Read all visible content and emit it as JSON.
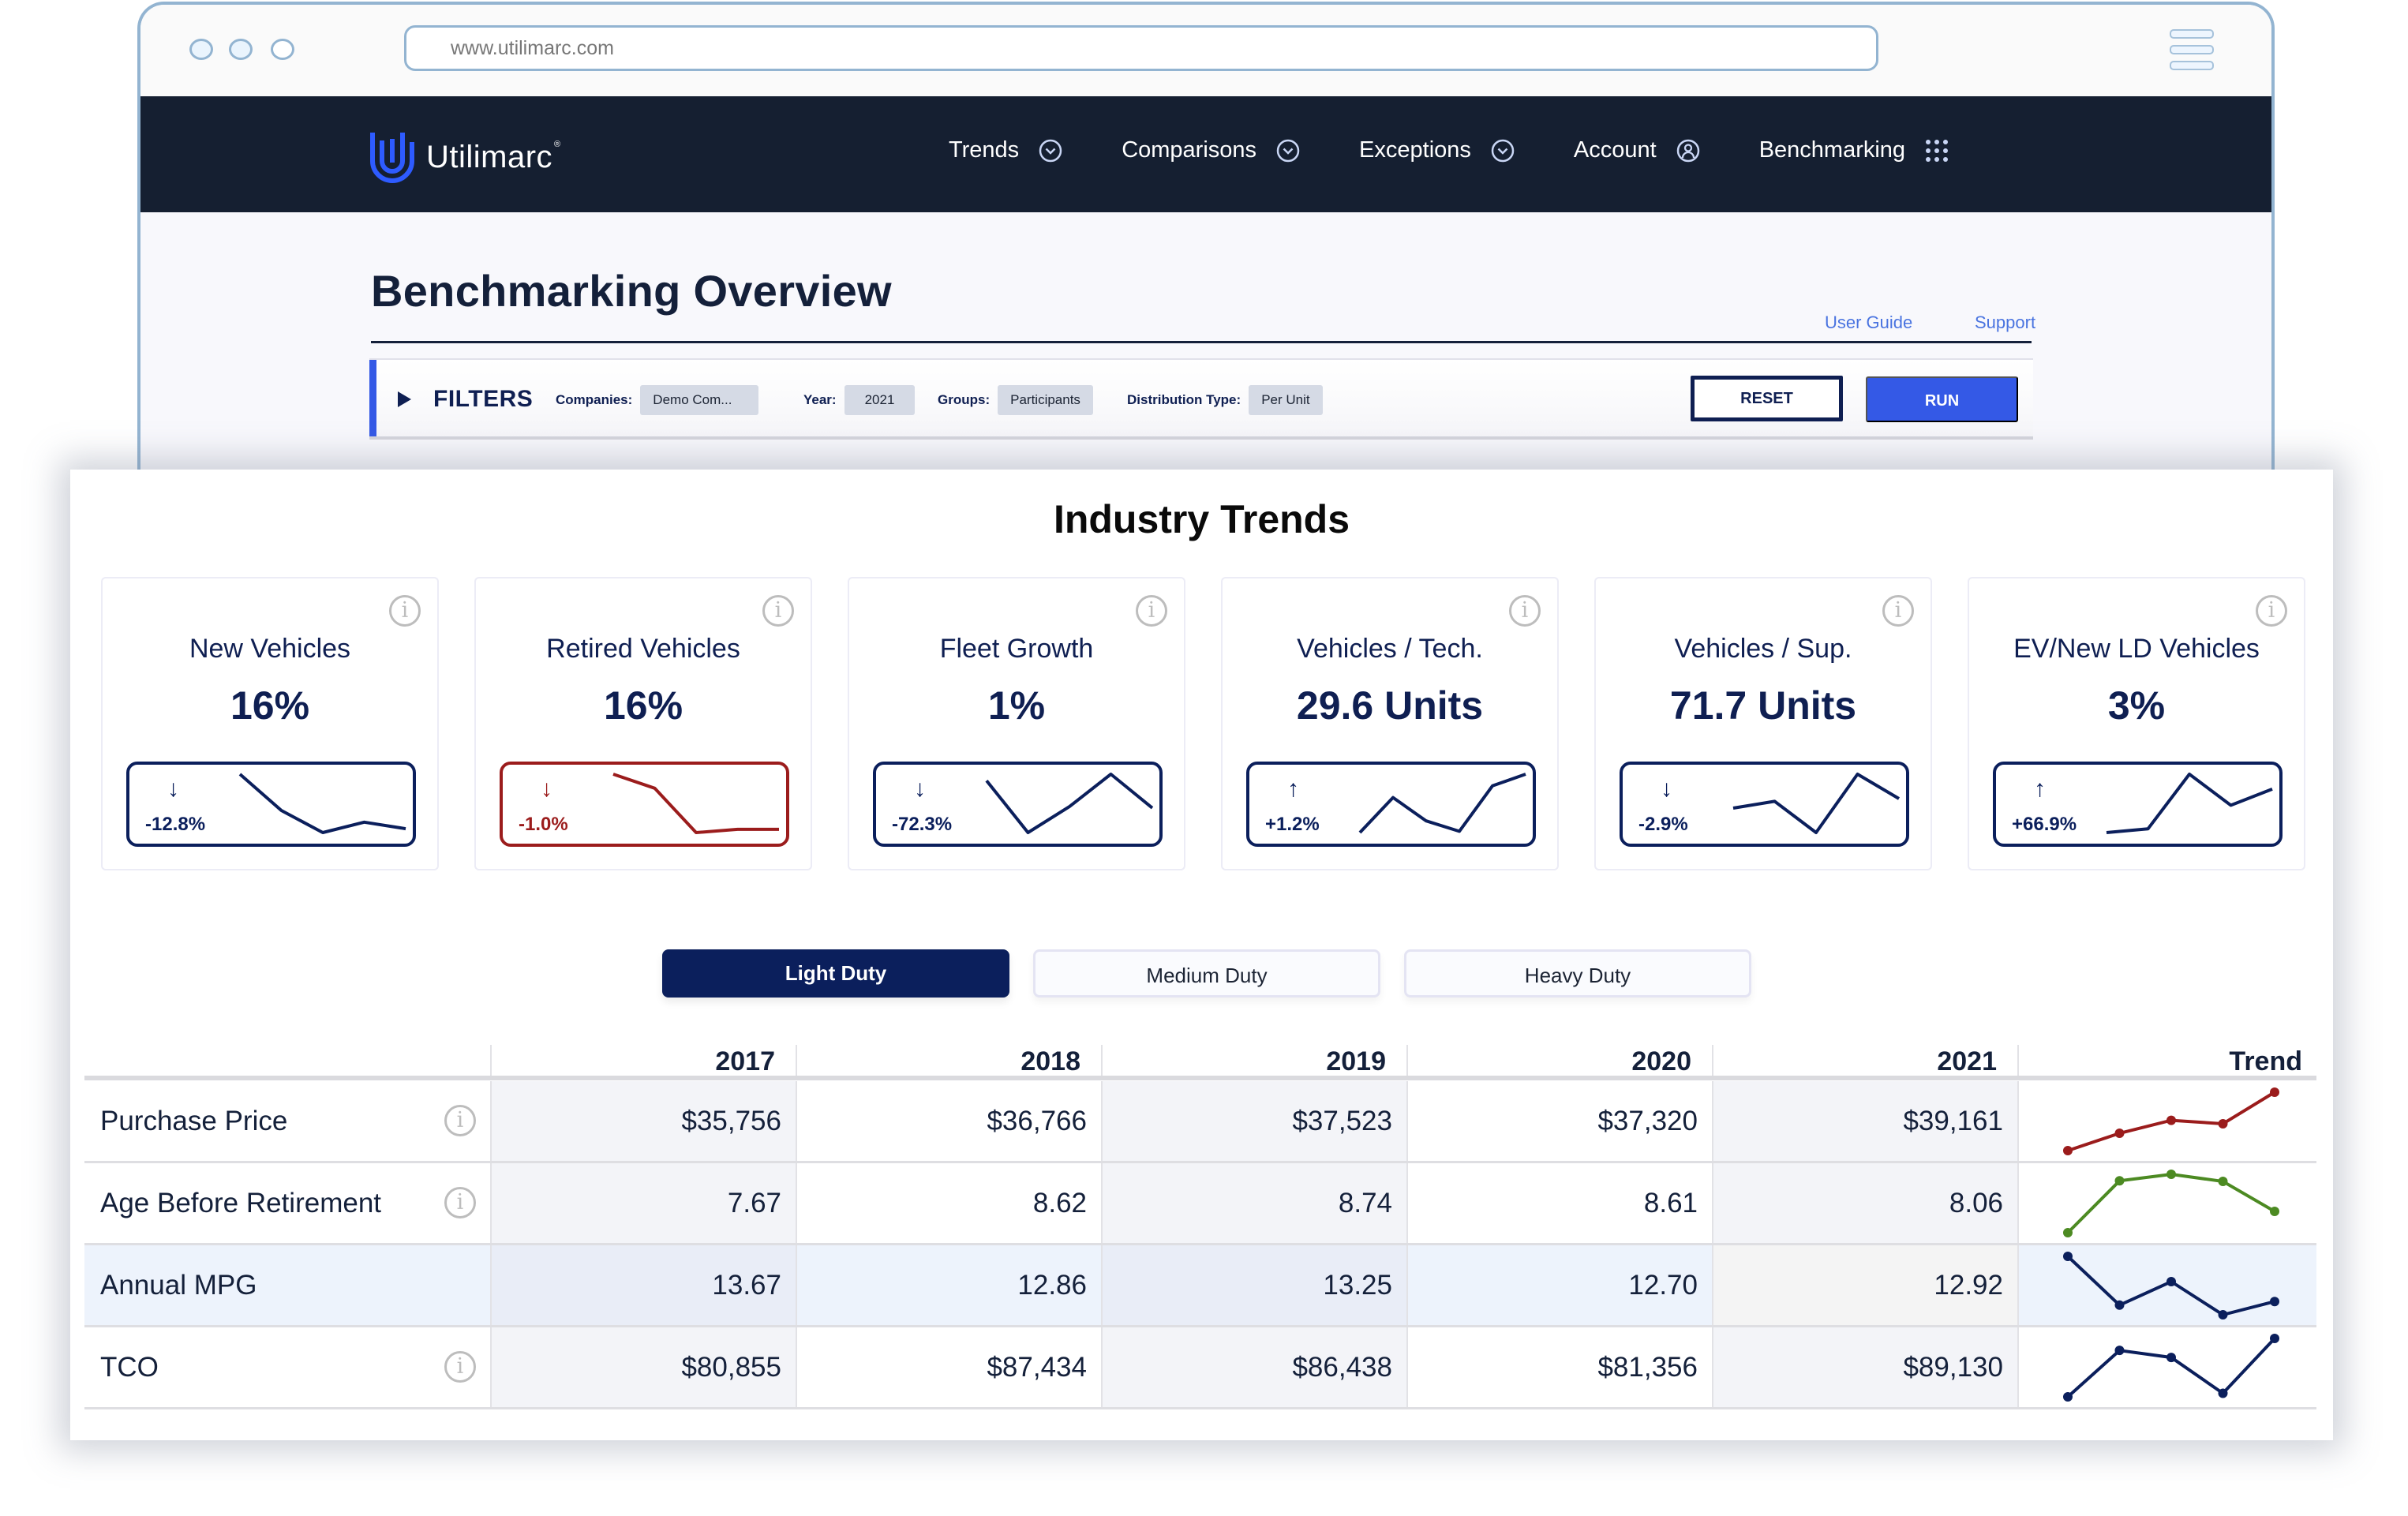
{
  "browser": {
    "url": "www.utilimarc.com"
  },
  "nav": {
    "brand": "Utilimarc",
    "brand_mark": "®",
    "items": [
      {
        "label": "Trends",
        "icon": "chevron-circle-down-icon"
      },
      {
        "label": "Comparisons",
        "icon": "chevron-circle-down-icon"
      },
      {
        "label": "Exceptions",
        "icon": "chevron-circle-down-icon"
      },
      {
        "label": "Account",
        "icon": "user-circle-icon"
      },
      {
        "label": "Benchmarking",
        "icon": "grid-dots-icon"
      }
    ]
  },
  "page": {
    "title": "Benchmarking Overview",
    "links": {
      "user_guide": "User Guide",
      "support": "Support"
    }
  },
  "filters": {
    "label": "FILTERS",
    "companies_label": "Companies:",
    "companies_value": "Demo Com...",
    "year_label": "Year:",
    "year_value": "2021",
    "groups_label": "Groups:",
    "groups_value": "Participants",
    "distribution_label": "Distribution Type:",
    "distribution_value": "Per Unit",
    "reset_label": "RESET",
    "run_label": "RUN"
  },
  "colors": {
    "navy": "#0B1F5C",
    "red": "#9B1C1C",
    "green": "#4C8A22",
    "accent_blue": "#3459E6",
    "nav_bg": "#151F31"
  },
  "panel": {
    "title": "Industry Trends",
    "cards": [
      {
        "title": "New Vehicles",
        "value": "16%",
        "delta": "-12.8%",
        "direction": "down",
        "tone": "navy",
        "trend": [
          5,
          2.2,
          0.5,
          1.3,
          0.8
        ]
      },
      {
        "title": "Retired Vehicles",
        "value": "16%",
        "delta": "-1.0%",
        "direction": "down",
        "tone": "red",
        "trend": [
          6,
          4.7,
          0.6,
          0.9,
          0.9
        ]
      },
      {
        "title": "Fleet Growth",
        "value": "1%",
        "delta": "-72.3%",
        "direction": "down",
        "tone": "navy",
        "trend": [
          5,
          1,
          3,
          5.5,
          2.9
        ]
      },
      {
        "title": "Vehicles / Tech.",
        "value": "29.6 Units",
        "delta": "+1.2%",
        "direction": "up",
        "tone": "navy",
        "trend": [
          0.5,
          3.2,
          1.4,
          0.6,
          4.1,
          5
        ]
      },
      {
        "title": "Vehicles / Sup.",
        "value": "71.7 Units",
        "delta": "-2.9%",
        "direction": "down",
        "tone": "navy",
        "trend": [
          2,
          2.5,
          0.2,
          4.5,
          2.7
        ]
      },
      {
        "title": "EV/New LD Vehicles",
        "value": "3%",
        "delta": "+66.9%",
        "direction": "up",
        "tone": "navy",
        "trend": [
          0.3,
          0.6,
          5,
          2.5,
          3.8
        ]
      }
    ],
    "duty_tabs": [
      {
        "label": "Light Duty",
        "active": true
      },
      {
        "label": "Medium Duty",
        "active": false
      },
      {
        "label": "Heavy Duty",
        "active": false
      }
    ],
    "table": {
      "columns": [
        "2017",
        "2018",
        "2019",
        "2020",
        "2021",
        "Trend"
      ],
      "rows": [
        {
          "label": "Purchase Price",
          "info": true,
          "values": [
            "$35,756",
            "$36,766",
            "$37,523",
            "$37,320",
            "$39,161"
          ],
          "trend": [
            35756,
            36766,
            37523,
            37320,
            39161
          ],
          "trend_color": "red",
          "highlight": false
        },
        {
          "label": "Age Before Retirement",
          "info": true,
          "values": [
            "7.67",
            "8.62",
            "8.74",
            "8.61",
            "8.06"
          ],
          "trend": [
            7.67,
            8.62,
            8.74,
            8.61,
            8.06
          ],
          "trend_color": "green",
          "highlight": false
        },
        {
          "label": "Annual MPG",
          "info": false,
          "values": [
            "13.67",
            "12.86",
            "13.25",
            "12.70",
            "12.92"
          ],
          "trend": [
            13.67,
            12.86,
            13.25,
            12.7,
            12.92
          ],
          "trend_color": "navy",
          "highlight": true
        },
        {
          "label": "TCO",
          "info": true,
          "values": [
            "$80,855",
            "$87,434",
            "$86,438",
            "$81,356",
            "$89,130"
          ],
          "trend": [
            80855,
            87434,
            86438,
            81356,
            89130
          ],
          "trend_color": "navy",
          "highlight": false
        }
      ]
    }
  }
}
